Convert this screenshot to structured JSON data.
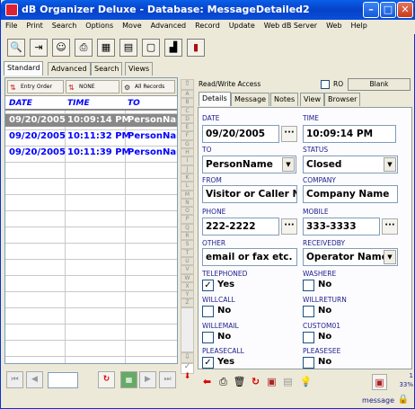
{
  "window": {
    "title": "dB Organizer Deluxe - Database: MessageDetailed2"
  },
  "menu": [
    "File",
    "Print",
    "Search",
    "Options",
    "Move",
    "Advanced",
    "Record",
    "Update",
    "Web dB Server",
    "Web",
    "Help"
  ],
  "left_tabs": [
    "Standard",
    "Advanced",
    "Search",
    "Views"
  ],
  "sort_buttons": {
    "entry_order": "Entry Order",
    "none": "NONE",
    "all_records": "All Records"
  },
  "grid": {
    "columns": [
      "DATE",
      "TIME",
      "TO"
    ],
    "rows": [
      {
        "date": "09/20/2005",
        "time": "10:09:14 PM",
        "to": "PersonNam"
      },
      {
        "date": "09/20/2005",
        "time": "10:11:32 PM",
        "to": "PersonNam"
      },
      {
        "date": "09/20/2005",
        "time": "10:11:39 PM",
        "to": "PersonNam"
      }
    ]
  },
  "alpha_letters": [
    "A",
    "B",
    "C",
    "D",
    "E",
    "F",
    "G",
    "H",
    "I",
    "J",
    "K",
    "L",
    "M",
    "N",
    "O",
    "P",
    "Q",
    "R",
    "S",
    "T",
    "U",
    "V",
    "W",
    "X",
    "Y",
    "Z"
  ],
  "record_header": {
    "mode": "Read/Write Access",
    "ro_label": "RO",
    "blank_label": "Blank"
  },
  "right_tabs": [
    "Details",
    "Message",
    "Notes",
    "View",
    "Browser"
  ],
  "fields": {
    "date": {
      "label": "DATE",
      "value": "09/20/2005"
    },
    "time": {
      "label": "TIME",
      "value": "10:09:14 PM"
    },
    "to": {
      "label": "TO",
      "value": "PersonName"
    },
    "status": {
      "label": "STATUS",
      "value": "Closed"
    },
    "from": {
      "label": "FROM",
      "value": "Visitor or Caller Nam"
    },
    "company": {
      "label": "COMPANY",
      "value": "Company Name"
    },
    "phone": {
      "label": "PHONE",
      "value": "222-2222"
    },
    "mobile": {
      "label": "MOBILE",
      "value": "333-3333"
    },
    "other": {
      "label": "OTHER",
      "value": "email or fax etc."
    },
    "receivedby": {
      "label": "RECEIVEDBY",
      "value": "Operator Name"
    }
  },
  "checks": {
    "telephoned": {
      "label": "TELEPHONED",
      "value": "Yes",
      "checked": true
    },
    "washere": {
      "label": "WASHERE",
      "value": "No",
      "checked": false
    },
    "willcall": {
      "label": "WILLCALL",
      "value": "No",
      "checked": false
    },
    "willreturn": {
      "label": "WILLRETURN",
      "value": "No",
      "checked": false
    },
    "willemail": {
      "label": "WILLEMAIL",
      "value": "No",
      "checked": false
    },
    "custom01": {
      "label": "CUSTOM01",
      "value": "No",
      "checked": false
    },
    "pleasecall": {
      "label": "PLEASECALL",
      "value": "Yes",
      "checked": true
    },
    "pleasesee": {
      "label": "PLEASESEE",
      "value": "No",
      "checked": false
    }
  },
  "status_bar": {
    "table": "message",
    "record": "1",
    "percent": "33%"
  }
}
